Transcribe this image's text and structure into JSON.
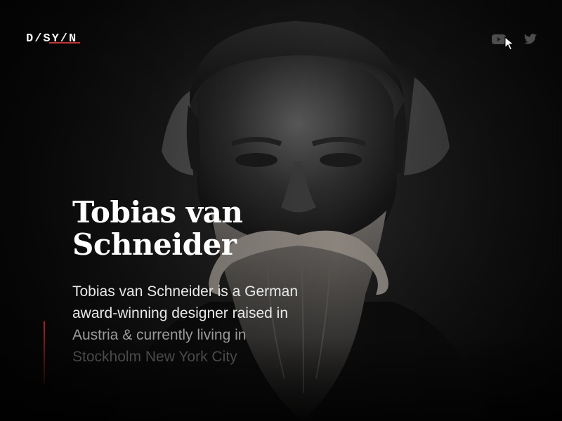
{
  "brand": {
    "logo_text": "D/SY/N",
    "accent_color": "#d12b2b"
  },
  "header": {
    "social": [
      {
        "name": "youtube",
        "icon": "youtube-icon"
      },
      {
        "name": "twitter",
        "icon": "twitter-icon"
      }
    ]
  },
  "hero": {
    "title_line1": "Tobias van",
    "title_line2": "Schneider",
    "bio_line1": "Tobias van Schneider is a German",
    "bio_line2": "award-winning designer raised in",
    "bio_line3": "Austria & currently living in",
    "bio_line4": "Stockholm New York City"
  },
  "background": {
    "image": "bearded-man-portrait"
  }
}
